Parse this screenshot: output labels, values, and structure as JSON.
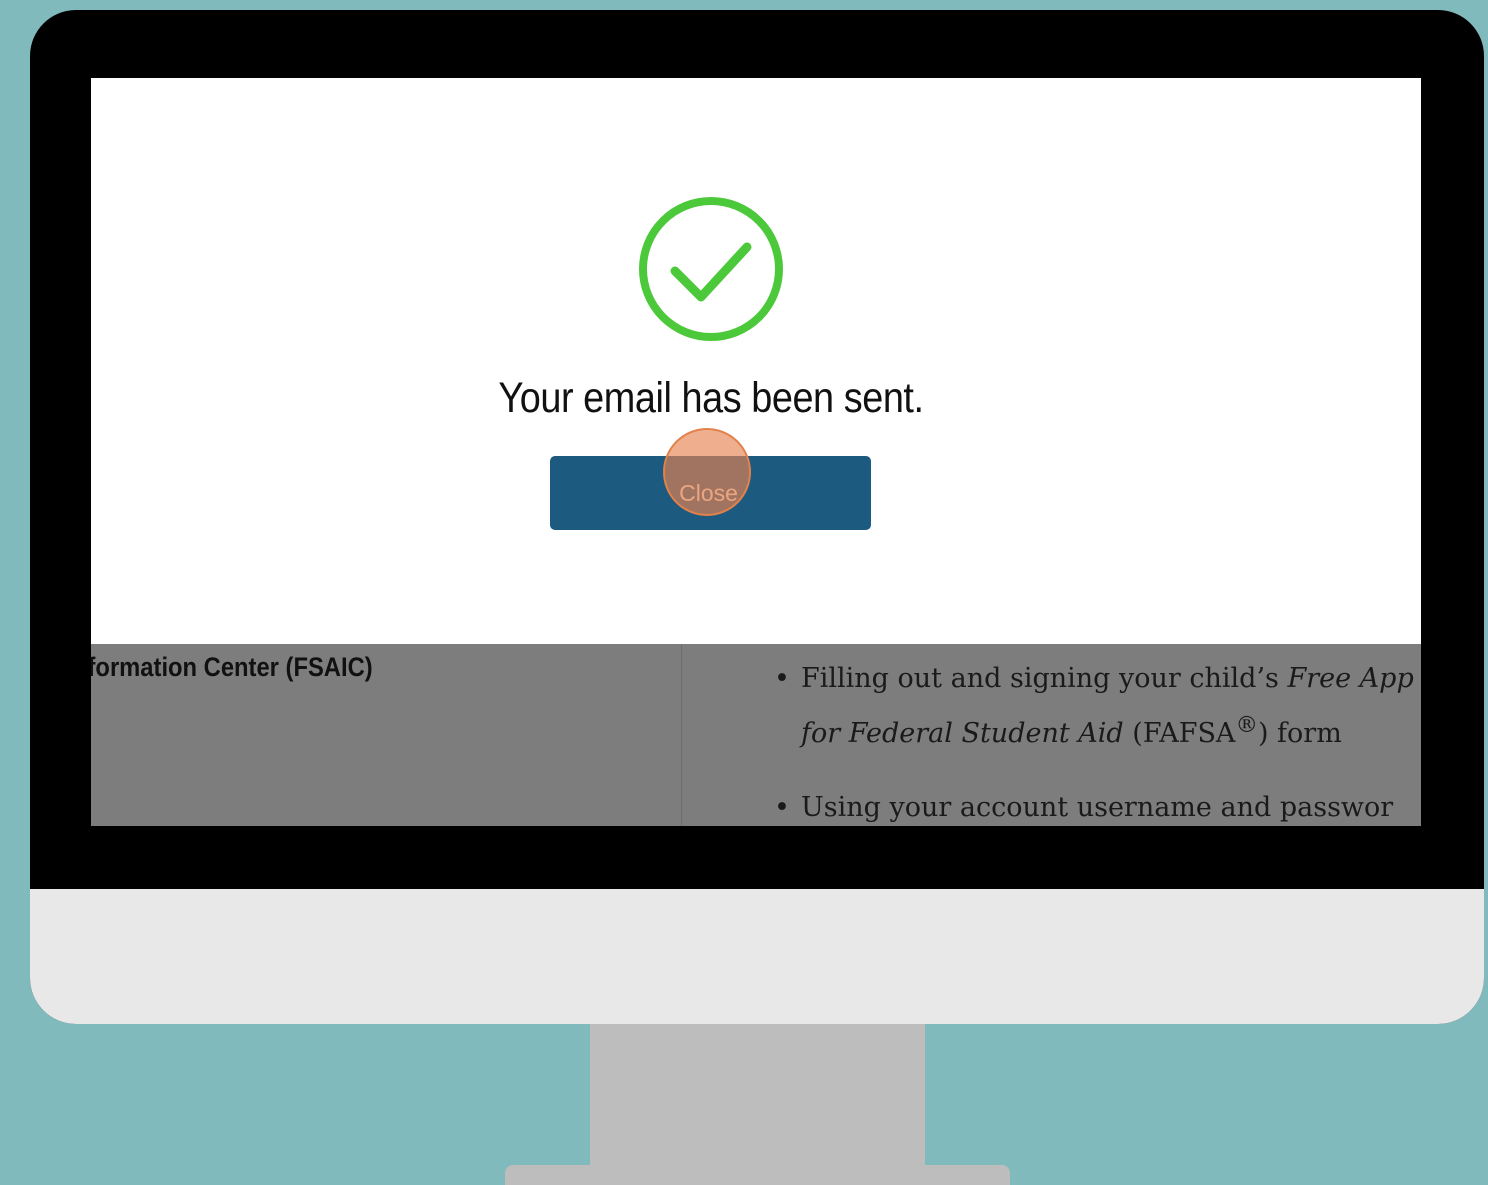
{
  "modal": {
    "title": "Your email has been sent.",
    "close_label": "Close",
    "success_icon": "check-circle-icon",
    "success_color": "#4cc93a",
    "button_color": "#1d5a80"
  },
  "background": {
    "heading": "nformation Center (FSAIC)",
    "bullets": [
      {
        "pre": "Filling out and signing your child’s ",
        "italic": "Free App",
        "italic2": "for Federal Student Aid",
        "post": " (FAFSA",
        "sup": "®",
        "post2": ") form"
      },
      {
        "text": "Using your account username and passwor"
      }
    ]
  }
}
